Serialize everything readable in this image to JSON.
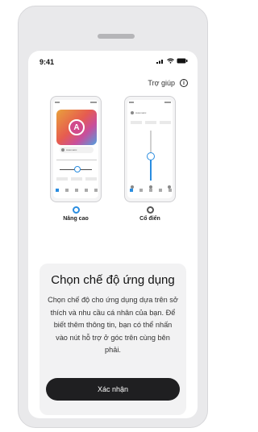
{
  "status": {
    "time": "9:41"
  },
  "header": {
    "help_label": "Trợ giúp",
    "help_icon": "i"
  },
  "preview_advanced": {
    "program": "Automatic",
    "letter": "A"
  },
  "preview_classic": {
    "program": "Automatic"
  },
  "modes": [
    {
      "label": "Nâng cao",
      "selected": true
    },
    {
      "label": "Cổ điển",
      "selected": false
    }
  ],
  "card": {
    "title": "Chọn chế độ ứng dụng",
    "description": "Chọn chế độ cho ứng dụng dựa trên sở thích và nhu cầu cá nhân của bạn. Để biết thêm thông tin, bạn có thể nhấn vào nút hỗ trợ ở góc trên cùng bên phải.",
    "confirm_label": "Xác nhận"
  },
  "colors": {
    "accent": "#2a8de0",
    "button": "#1f1f21"
  }
}
